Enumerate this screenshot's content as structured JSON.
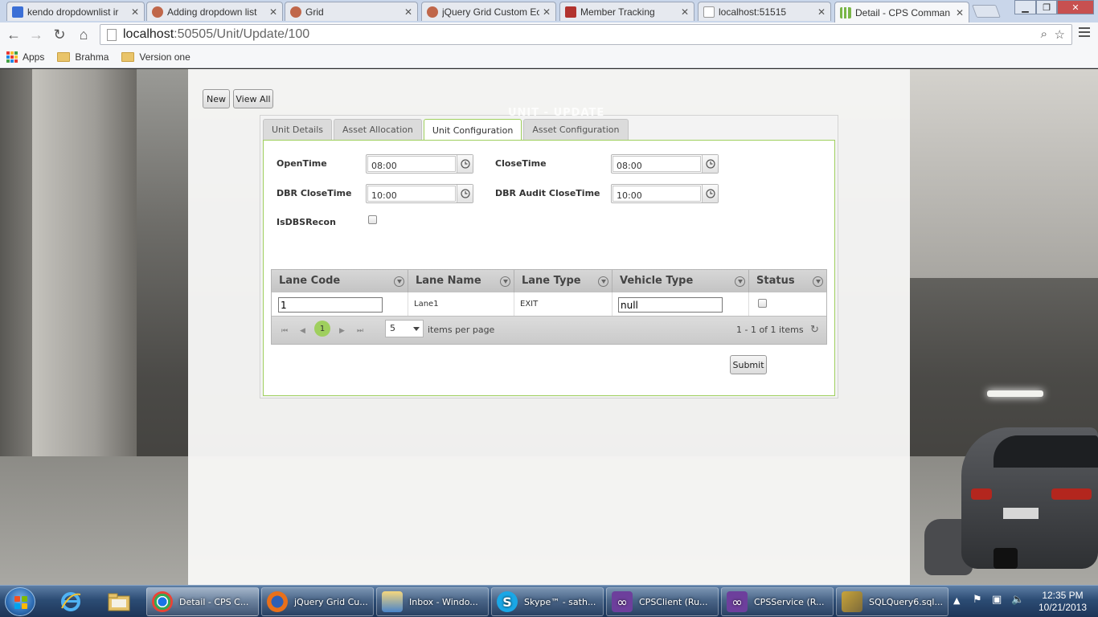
{
  "browser": {
    "tabs": [
      {
        "title": "kendo dropdownlist ir",
        "favicon_color": "#3b6fd6"
      },
      {
        "title": "Adding dropdown list",
        "favicon_color": "#c0674a"
      },
      {
        "title": "Grid",
        "favicon_color": "#c0674a"
      },
      {
        "title": "jQuery Grid Custom Ec",
        "favicon_color": "#c0674a"
      },
      {
        "title": "Member Tracking",
        "favicon_color": "#b2332e"
      },
      {
        "title": "localhost:51515",
        "favicon_color": "#e0e0e0"
      },
      {
        "title": "Detail - CPS Comman",
        "favicon_color": "#7ab648"
      }
    ],
    "url_host": "localhost",
    "url_path": ":50505/Unit/Update/100",
    "bookmarks": [
      "Apps",
      "Brahma",
      "Version one"
    ]
  },
  "page": {
    "new_button": "New",
    "view_all_button": "View All",
    "watermark": "UNIT - UPDATE",
    "tabs": [
      "Unit Details",
      "Asset Allocation",
      "Unit Configuration",
      "Asset Configuration"
    ],
    "active_tab": "Unit Configuration",
    "form": {
      "open_time_label": "OpenTime",
      "open_time_value": "08:00",
      "close_time_label": "CloseTime",
      "close_time_value": "08:00",
      "dbr_close_time_label": "DBR CloseTime",
      "dbr_close_time_value": "10:00",
      "dbr_audit_close_time_label": "DBR Audit CloseTime",
      "dbr_audit_close_time_value": "10:00",
      "is_dbs_recon_label": "IsDBSRecon",
      "is_dbs_recon_checked": false
    },
    "grid": {
      "columns": [
        "Lane Code",
        "Lane Name",
        "Lane Type",
        "Vehicle Type",
        "Status"
      ],
      "rows": [
        {
          "lane_code": "1",
          "lane_name": "Lane1",
          "lane_type": "EXIT",
          "vehicle_type": "null",
          "status": false
        }
      ],
      "pager": {
        "current_page": "1",
        "page_size": "5",
        "items_per_page_label": "items per page",
        "summary": "1 - 1 of 1 items"
      }
    },
    "submit_button": "Submit"
  },
  "taskbar": {
    "tasks": [
      {
        "label": "Detail - CPS C...",
        "icon_color": "#2e7fd3"
      },
      {
        "label": "jQuery Grid Cu...",
        "icon_color": "#e8701a"
      },
      {
        "label": "Inbox - Windo...",
        "icon_color": "#4a84c9"
      },
      {
        "label": "Skype™ - sath...",
        "icon_color": "#1aa7e6"
      },
      {
        "label": "CPSClient (Ru...",
        "icon_color": "#6d3f9c"
      },
      {
        "label": "CPSService (R...",
        "icon_color": "#6d3f9c"
      },
      {
        "label": "SQLQuery6.sql...",
        "icon_color": "#c8a43a"
      }
    ],
    "time": "12:35 PM",
    "date": "10/21/2013"
  }
}
